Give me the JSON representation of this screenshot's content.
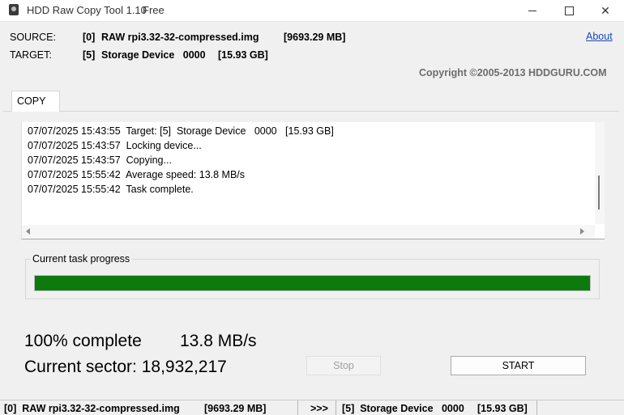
{
  "window": {
    "title": "HDD Raw Copy Tool 1.10",
    "edition": "Free"
  },
  "source": {
    "label": "SOURCE:",
    "index": "[0]",
    "name": "RAW rpi3.32-32-compressed.img",
    "size": "[9693.29 MB]"
  },
  "target": {
    "label": "TARGET:",
    "index": "[5]",
    "name": "Storage Device   0000",
    "size": "[15.93 GB]"
  },
  "about_label": "About",
  "copyright": "Copyright ©2005-2013 HDDGURU.COM",
  "tabs": [
    "COPY"
  ],
  "log": [
    "07/07/2025 15:43:55  Target: [5]  Storage Device   0000   [15.93 GB]",
    "07/07/2025 15:43:57  Locking device...",
    "07/07/2025 15:43:57  Copying...",
    "07/07/2025 15:55:42  Average speed: 13.8 MB/s",
    "07/07/2025 15:55:42  Task complete."
  ],
  "progress": {
    "label": "Current task progress",
    "fraction": 1.0,
    "complete_text": "100% complete",
    "speed_text": "13.8 MB/s",
    "sector_text": "Current sector: 18,932,217"
  },
  "buttons": {
    "stop": "Stop",
    "start": "START"
  },
  "statusbar": {
    "source": "[0]  RAW rpi3.32-32-compressed.img",
    "source_size": "[9693.29 MB]",
    "arrow": ">>>",
    "target": "[5]  Storage Device   0000",
    "target_size": "[15.93 GB]"
  },
  "colors": {
    "progress_fill": "#0c7a0c",
    "link": "#1a47b8"
  }
}
